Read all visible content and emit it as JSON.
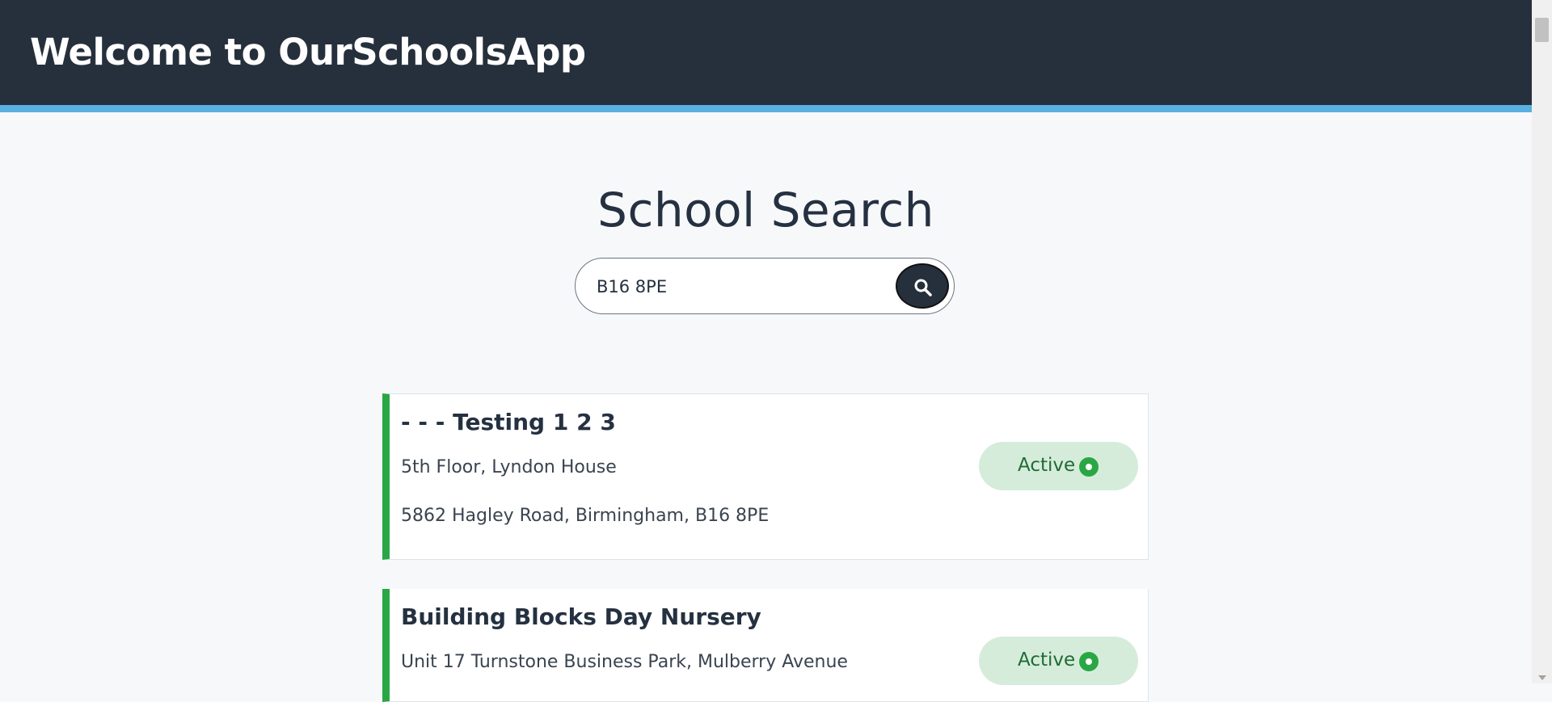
{
  "header": {
    "title": "Welcome to OurSchoolsApp"
  },
  "page": {
    "title": "School Search"
  },
  "search": {
    "value": "B16 8PE"
  },
  "results": [
    {
      "name": "- - - Testing 1 2 3",
      "address_line1": "5th Floor, Lyndon House",
      "address_line2": "5862 Hagley Road, Birmingham, B16 8PE",
      "status": "Active"
    },
    {
      "name": "Building Blocks Day Nursery",
      "address_line1": "Unit 17 Turnstone Business Park, Mulberry Avenue",
      "status": "Active"
    }
  ],
  "icons": {
    "search_button": "search-icon",
    "status": "active-dot-icon"
  },
  "colors": {
    "header_bg": "#26303c",
    "header_accent": "#5ab0e0",
    "active_green": "#2aa745",
    "badge_bg": "#d6ecdb"
  }
}
